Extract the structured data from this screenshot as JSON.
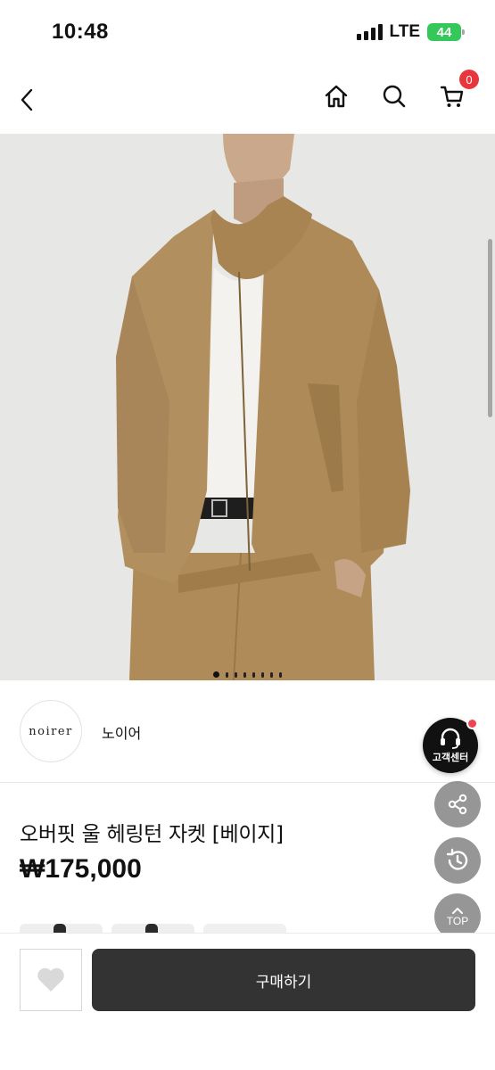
{
  "status": {
    "time": "10:48",
    "network": "LTE",
    "battery": "44"
  },
  "nav": {
    "cart_count": "0"
  },
  "product": {
    "brand_logo_text": "noirer",
    "brand_name": "노이어",
    "title": "오버핏 울 헤링턴 자켓 [베이지]",
    "price": "₩175,000",
    "image_count": 8,
    "current_image": 1
  },
  "floating": {
    "cs_label": "고객센터",
    "top_label": "TOP"
  },
  "bottom": {
    "buy_label": "구매하기"
  },
  "colors": {
    "accent_red": "#e8363c",
    "buy_button": "#333333",
    "jacket": "#b08e5f"
  }
}
